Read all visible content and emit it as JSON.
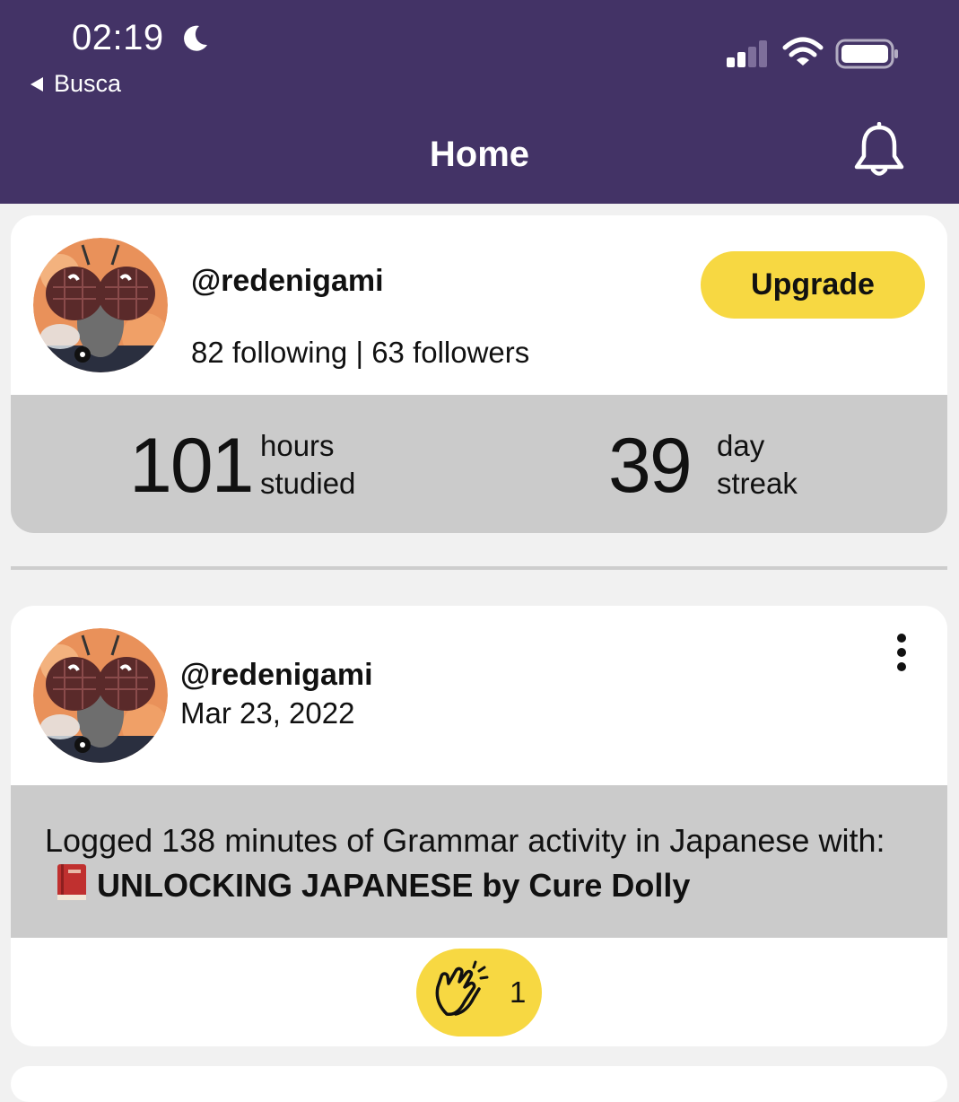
{
  "status_bar": {
    "time": "02:19",
    "back_label": "Busca",
    "icons": [
      "moon-icon",
      "signal-icon",
      "wifi-icon",
      "battery-icon"
    ]
  },
  "header": {
    "title": "Home",
    "notifications_icon": "bell-icon",
    "background_color": "#433366"
  },
  "profile": {
    "username": "@redenigami",
    "follow_stats": "82 following | 63 followers",
    "upgrade_label": "Upgrade",
    "upgrade_color": "#f7d842",
    "stats": {
      "hours_value": "101",
      "hours_unit": "hours",
      "hours_desc": "studied",
      "streak_value": "39",
      "streak_unit": "day",
      "streak_desc": "streak"
    }
  },
  "post": {
    "username": "@redenigami",
    "date": "Mar 23, 2022",
    "activity_prefix": "Logged 138 minutes of Grammar activity in Japanese with:",
    "activity_title": "UNLOCKING JAPANESE by Cure Dolly",
    "book_icon": "red-book-icon",
    "clap_count": "1",
    "clap_icon": "clapping-hands-icon",
    "more_icon": "more-vertical-icon"
  }
}
